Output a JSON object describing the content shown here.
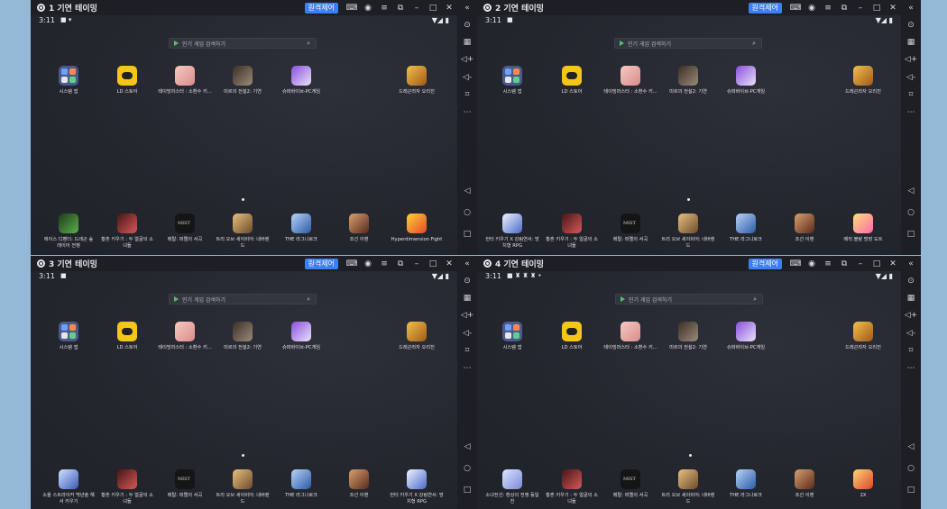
{
  "windows": [
    {
      "title": "1 기연 테이밍",
      "remote": "원격제어",
      "time": "3:11",
      "top_apps": [
        {
          "label": "시스템 앱",
          "icon": "system-apps-icon"
        },
        {
          "label": "LD 스토어",
          "icon": "ld-store-icon"
        },
        {
          "label": "테이밍마스터 : 소환수 키...",
          "icon": "taming-master-icon"
        },
        {
          "label": "미르의 전설2: 기연",
          "icon": "mir-legend-icon"
        },
        {
          "label": "슈퍼바이브-PC게임",
          "icon": "supervive-icon"
        },
        {
          "label": "드래곤라자 오리진",
          "icon": "dragon-raja-icon"
        }
      ],
      "bottom_apps": [
        {
          "label": "에이스 디펜더: 드래곤 숲 레이어 전쟁",
          "icon": "ace-defender-icon"
        },
        {
          "label": "황혼 키우기 : 두 얼굴의 소녀들",
          "icon": "twilight-icon"
        },
        {
          "label": "메탈: 퍼렐의 서곡",
          "icon": "mist-icon"
        },
        {
          "label": "트리 오브 세이비어: 네버랜드",
          "icon": "tree-of-savior-icon"
        },
        {
          "label": "THE 라그나로크",
          "icon": "ragnarok-icon"
        },
        {
          "label": "조선 이맨",
          "icon": "joseon-icon"
        },
        {
          "label": "Hyperdimension Fight",
          "icon": "hyperdimension-icon"
        }
      ]
    },
    {
      "title": "2 기연 테이밍",
      "remote": "원격제어",
      "time": "3:11",
      "top_apps": [
        {
          "label": "시스템 앱",
          "icon": "system-apps-icon"
        },
        {
          "label": "LD 스토어",
          "icon": "ld-store-icon"
        },
        {
          "label": "테이밍마스터 : 소환수 키...",
          "icon": "taming-master-icon"
        },
        {
          "label": "미르의 전설2: 기연",
          "icon": "mir-legend-icon"
        },
        {
          "label": "슈퍼바이브-PC게임",
          "icon": "supervive-icon"
        },
        {
          "label": "드래곤라자 오리진",
          "icon": "dragon-raja-icon"
        }
      ],
      "bottom_apps": [
        {
          "label": "헌터 키우기 X 강림연서: 방치형 RPG",
          "icon": "hunter-icon"
        },
        {
          "label": "황혼 키우기 : 두 얼굴의 소녀들",
          "icon": "twilight-icon"
        },
        {
          "label": "메탈: 퍼렐의 서곡",
          "icon": "mist-icon"
        },
        {
          "label": "트리 오브 세이비어: 네버랜드",
          "icon": "tree-of-savior-icon"
        },
        {
          "label": "THE 라그나로크",
          "icon": "ragnarok-icon"
        },
        {
          "label": "조선 이맨",
          "icon": "joseon-icon"
        },
        {
          "label": "메직 블랑 방장 도트",
          "icon": "magic-blanc-icon"
        }
      ]
    },
    {
      "title": "3 기연 테이밍",
      "remote": "원격제어",
      "time": "3:11",
      "top_apps": [
        {
          "label": "시스템 앱",
          "icon": "system-apps-icon"
        },
        {
          "label": "LD 스토어",
          "icon": "ld-store-icon"
        },
        {
          "label": "테이밍마스터 : 소환수 키...",
          "icon": "taming-master-icon"
        },
        {
          "label": "미르의 전설2: 기연",
          "icon": "mir-legend-icon"
        },
        {
          "label": "슈퍼바이브-PC게임",
          "icon": "supervive-icon"
        },
        {
          "label": "드래곤라자 오리진",
          "icon": "dragon-raja-icon"
        }
      ],
      "bottom_apps": [
        {
          "label": "소울 스트라이커 백년술 해서 키우기",
          "icon": "soul-striker-icon"
        },
        {
          "label": "황혼 키우기 : 두 얼굴의 소녀들",
          "icon": "twilight-icon"
        },
        {
          "label": "메탈: 퍼렐의 서곡",
          "icon": "mist-icon"
        },
        {
          "label": "트리 오브 세이비어: 네버랜드",
          "icon": "tree-of-savior-icon"
        },
        {
          "label": "THE 라그나로크",
          "icon": "ragnarok-icon"
        },
        {
          "label": "조선 이맨",
          "icon": "joseon-icon"
        },
        {
          "label": "헌터 키우기 X 강림연서: 방치형 RPG",
          "icon": "hunter-icon"
        }
      ]
    },
    {
      "title": "4 기연 테이밍",
      "remote": "원격제어",
      "time": "3:11",
      "top_apps": [
        {
          "label": "시스템 앱",
          "icon": "system-apps-icon"
        },
        {
          "label": "LD 스토어",
          "icon": "ld-store-icon"
        },
        {
          "label": "테이밍마스터 : 소환수 키...",
          "icon": "taming-master-icon"
        },
        {
          "label": "미르의 전설2: 기연",
          "icon": "mir-legend-icon"
        },
        {
          "label": "슈퍼바이브-PC게임",
          "icon": "supervive-icon"
        },
        {
          "label": "드래곤라자 오리진",
          "icon": "dragon-raja-icon"
        }
      ],
      "bottom_apps": [
        {
          "label": "소녀전선: 환상의 전쟁 동일 진",
          "icon": "girls-frontline-icon"
        },
        {
          "label": "황혼 키우기 : 두 얼굴의 소녀들",
          "icon": "twilight-icon"
        },
        {
          "label": "메탈: 퍼렐의 서곡",
          "icon": "mist-icon"
        },
        {
          "label": "트리 오브 세이비어: 네버랜드",
          "icon": "tree-of-savior-icon"
        },
        {
          "label": "THE 라그나로크",
          "icon": "ragnarok-icon"
        },
        {
          "label": "조선 이맨",
          "icon": "joseon-icon"
        },
        {
          "label": "2X",
          "icon": "2x-icon"
        }
      ]
    }
  ],
  "search_placeholder": "인기 게임 검색하기",
  "colors": {
    "accent": "#3c7ef3",
    "titlebar": "#1e1f25",
    "screen": "#24262e",
    "desktop": "#93b9d6"
  }
}
